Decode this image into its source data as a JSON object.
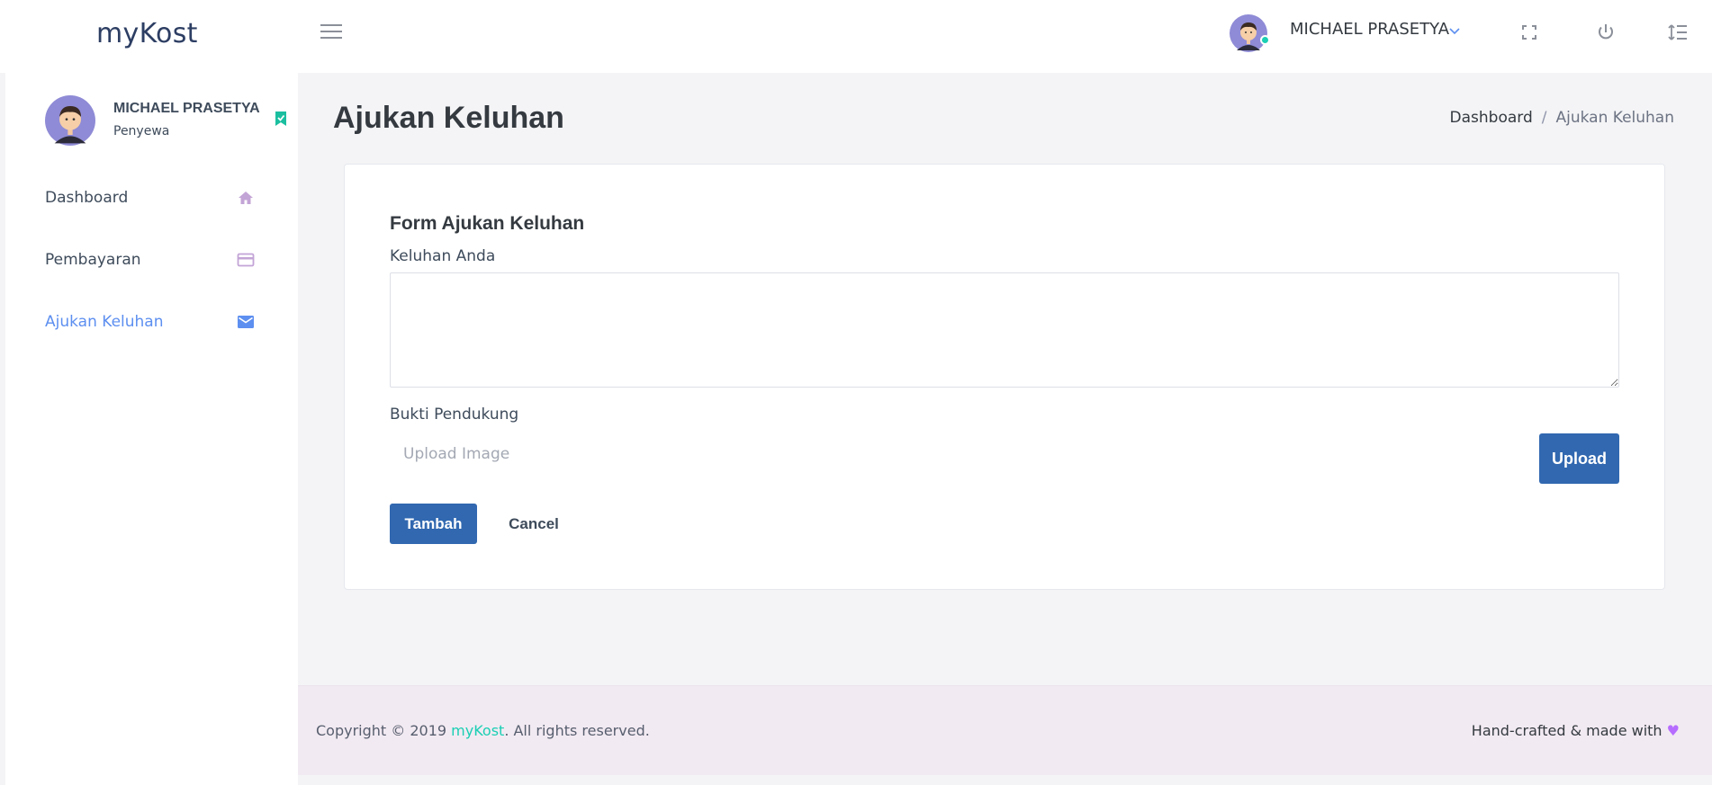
{
  "app": {
    "brand": "myKost"
  },
  "topbar": {
    "username": "MICHAEL PRASETYA",
    "icons": [
      "menu-icon",
      "chevron-down-icon",
      "fullscreen-icon",
      "power-icon",
      "format-line-spacing-icon"
    ]
  },
  "sidebar": {
    "profile": {
      "name": "MICHAEL PRASETYA",
      "role": "Penyewa"
    },
    "items": [
      {
        "label": "Dashboard",
        "icon": "home-icon",
        "active": false
      },
      {
        "label": "Pembayaran",
        "icon": "credit-card-icon",
        "active": false
      },
      {
        "label": "Ajukan Keluhan",
        "icon": "email-icon",
        "active": true
      }
    ]
  },
  "page": {
    "title": "Ajukan Keluhan",
    "breadcrumb": {
      "parent": "Dashboard",
      "separator": "/",
      "current": "Ajukan Keluhan"
    }
  },
  "form": {
    "title": "Form Ajukan Keluhan",
    "complaint_label": "Keluhan Anda",
    "complaint_value": "",
    "evidence_label": "Bukti Pendukung",
    "upload_placeholder": "Upload Image",
    "upload_button": "Upload",
    "submit_button": "Tambah",
    "cancel_button": "Cancel"
  },
  "footer": {
    "copyright_prefix": "Copyright © 2019 ",
    "copyright_brand": "myKost",
    "copyright_suffix": ". All rights reserved.",
    "handcrafted": "Hand-crafted & made with ",
    "heart": "♥"
  },
  "colors": {
    "accent": "#5d8ff0",
    "primary_button": "#3168b0",
    "success": "#1bcfb4",
    "footer_bg": "#f2eaf2"
  }
}
